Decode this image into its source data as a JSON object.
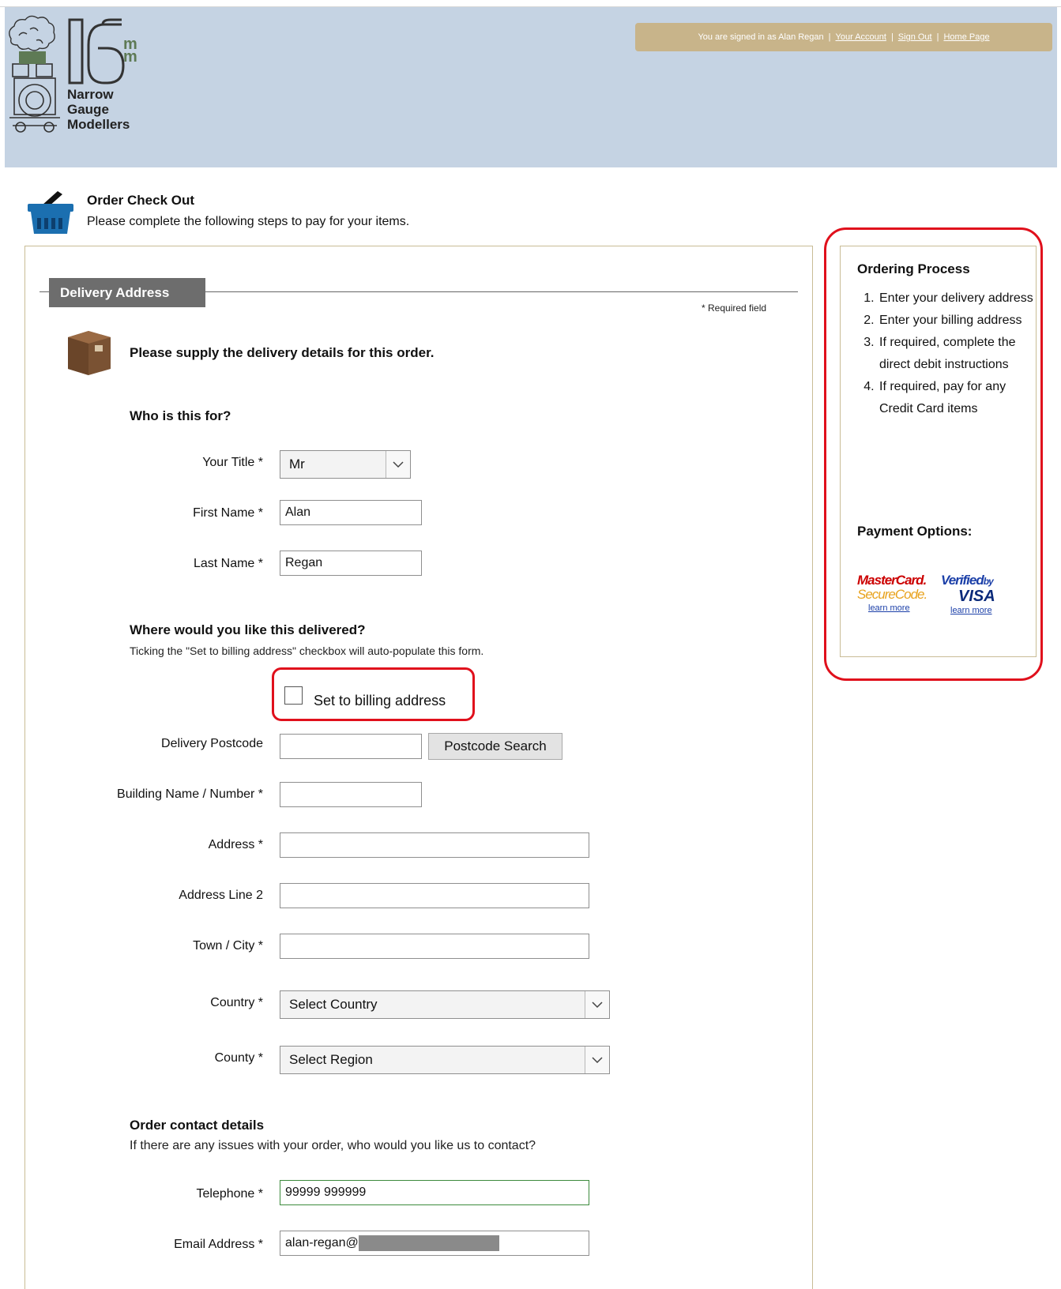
{
  "header": {
    "logo": {
      "number": "16",
      "unit_top": "m",
      "unit_bottom": "m",
      "lines": [
        "Narrow",
        "Gauge",
        "Modellers"
      ]
    },
    "userbar": {
      "signed_in": "You are signed in as Alan Regan",
      "account_link": "Your Account",
      "signout_link": "Sign Out",
      "home_link": "Home Page"
    }
  },
  "page": {
    "title": "Order Check Out",
    "subtitle": "Please complete the following steps to pay for your items."
  },
  "form": {
    "legend": "Delivery Address",
    "required_note": "* Required field",
    "supply_text": "Please supply the delivery details for this order.",
    "who_heading": "Who is this for?",
    "title_label": "Your Title *",
    "title_value": "Mr",
    "first_name_label": "First Name *",
    "first_name_value": "Alan",
    "last_name_label": "Last Name *",
    "last_name_value": "Regan",
    "where_heading": "Where would you like this delivered?",
    "where_desc": "Ticking the \"Set to billing address\" checkbox will auto-populate this form.",
    "billing_checkbox_label": "Set to billing address",
    "postcode_label": "Delivery Postcode",
    "postcode_value": "",
    "postcode_button": "Postcode Search",
    "building_label": "Building Name / Number *",
    "building_value": "",
    "address_label": "Address *",
    "address_value": "",
    "address2_label": "Address Line 2",
    "address2_value": "",
    "town_label": "Town / City *",
    "town_value": "",
    "country_label": "Country *",
    "country_value": "Select Country",
    "county_label": "County *",
    "county_value": "Select Region",
    "contact_heading": "Order contact details",
    "contact_desc": "If there are any issues with your order, who would you like us to contact?",
    "telephone_label": "Telephone *",
    "telephone_value": "99999 999999",
    "email_label": "Email Address *",
    "email_value": "alan-regan@"
  },
  "sidebar": {
    "heading": "Ordering Process",
    "steps": [
      "Enter your delivery address",
      "Enter your billing address",
      "If required, complete the direct debit instructions",
      "If required, pay for any Credit Card items"
    ],
    "payment_heading": "Payment Options:",
    "mastercard_line1": "MasterCard.",
    "mastercard_line2": "SecureCode.",
    "visa_line1": "Verified",
    "visa_by": "by",
    "visa_line2": "VISA",
    "learn_more": "learn more"
  },
  "colors": {
    "header_bg": "#c5d3e3",
    "userbar_bg": "#c8b48a",
    "legend_bg": "#6d6d6d",
    "highlight_ring": "#e0101c"
  }
}
